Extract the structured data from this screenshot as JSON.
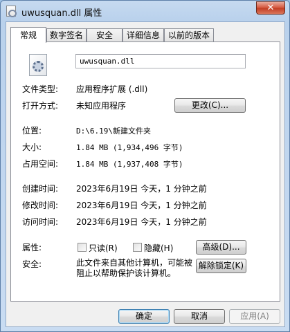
{
  "window": {
    "title": "uwusquan.dll 属性",
    "close_glyph": "✕"
  },
  "tabs": [
    {
      "label": "常规",
      "active": true
    },
    {
      "label": "数字签名",
      "active": false
    },
    {
      "label": "安全",
      "active": false
    },
    {
      "label": "详细信息",
      "active": false
    },
    {
      "label": "以前的版本",
      "active": false
    }
  ],
  "general": {
    "file_name": "uwusquan.dll",
    "file_type_label": "文件类型:",
    "file_type_value": "应用程序扩展 (.dll)",
    "open_with_label": "打开方式:",
    "open_with_value": "未知应用程序",
    "change_button": "更改(C)...",
    "location_label": "位置:",
    "location_value": "D:\\6.19\\新建文件夹",
    "size_label": "大小:",
    "size_value": "1.84 MB (1,934,496 字节)",
    "size_on_disk_label": "占用空间:",
    "size_on_disk_value": "1.84 MB (1,937,408 字节)",
    "created_label": "创建时间:",
    "created_value": "2023年6月19日 今天，1 分钟之前",
    "modified_label": "修改时间:",
    "modified_value": "2023年6月19日 今天，1 分钟之前",
    "accessed_label": "访问时间:",
    "accessed_value": "2023年6月19日 今天，1 分钟之前",
    "attributes_label": "属性:",
    "readonly_label": "只读(R)",
    "hidden_label": "隐藏(H)",
    "advanced_button": "高级(D)...",
    "security_label": "安全:",
    "security_text": "此文件来自其他计算机，可能被阻止以帮助保护该计算机。",
    "unblock_button": "解除锁定(K)"
  },
  "footer": {
    "ok": "确定",
    "cancel": "取消",
    "apply": "应用(A)"
  }
}
